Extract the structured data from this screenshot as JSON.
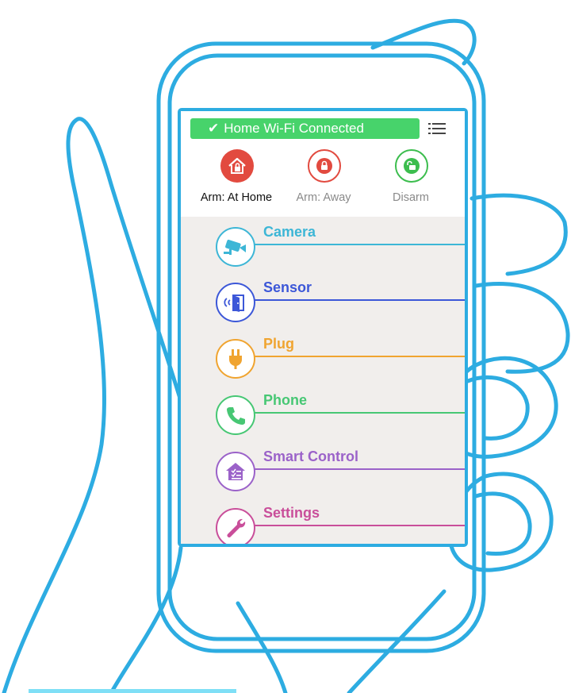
{
  "colors": {
    "outline": "#22a8e0",
    "wifi_green": "#47d36b",
    "arm_home_red": "#e24a3f",
    "arm_away_red": "#e24a3f",
    "disarm_green": "#3cbd4e",
    "camera": "#3db6d6",
    "sensor": "#3c57d8",
    "plug": "#f0a430",
    "phone": "#47c774",
    "smart_control": "#9b62c9",
    "settings": "#c94e9a"
  },
  "header": {
    "wifi_check_icon": "check-icon",
    "wifi_status": "Home Wi-Fi Connected",
    "menu_icon": "list-menu-icon"
  },
  "modes": [
    {
      "label": "Arm: At Home",
      "icon": "home-lock-icon",
      "selected": true
    },
    {
      "label": "Arm: Away",
      "icon": "lock-icon",
      "selected": false
    },
    {
      "label": "Disarm",
      "icon": "unlock-icon",
      "selected": false
    }
  ],
  "menu": [
    {
      "label": "Camera",
      "icon": "camera-icon"
    },
    {
      "label": "Sensor",
      "icon": "door-sensor-icon"
    },
    {
      "label": "Plug",
      "icon": "plug-icon"
    },
    {
      "label": "Phone",
      "icon": "phone-icon"
    },
    {
      "label": "Smart Control",
      "icon": "smart-home-icon"
    },
    {
      "label": "Settings",
      "icon": "wrench-icon"
    }
  ]
}
